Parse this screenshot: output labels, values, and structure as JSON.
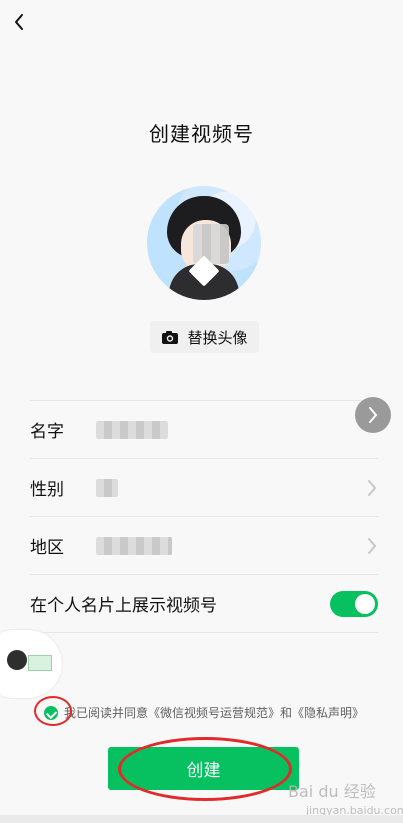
{
  "header": {
    "title": "创建视频号"
  },
  "avatar": {
    "replace_label": "替换头像"
  },
  "form": {
    "rows": [
      {
        "label": "名字"
      },
      {
        "label": "性别"
      },
      {
        "label": "地区"
      },
      {
        "label": "在个人名片上展示视频号"
      }
    ],
    "toggle_on": true
  },
  "agreement": {
    "text": "我已阅读并同意《微信视频号运营规范》和《隐私声明》"
  },
  "actions": {
    "create_label": "创建"
  },
  "watermark": {
    "main": "Bai du 经验",
    "sub": "jingyan.baidu.com"
  },
  "icons": {
    "back": "back-icon",
    "camera": "camera-icon",
    "chevron": "chevron-right-icon",
    "check": "check-icon"
  },
  "colors": {
    "accent": "#07c160",
    "highlight": "#e12b2b"
  }
}
